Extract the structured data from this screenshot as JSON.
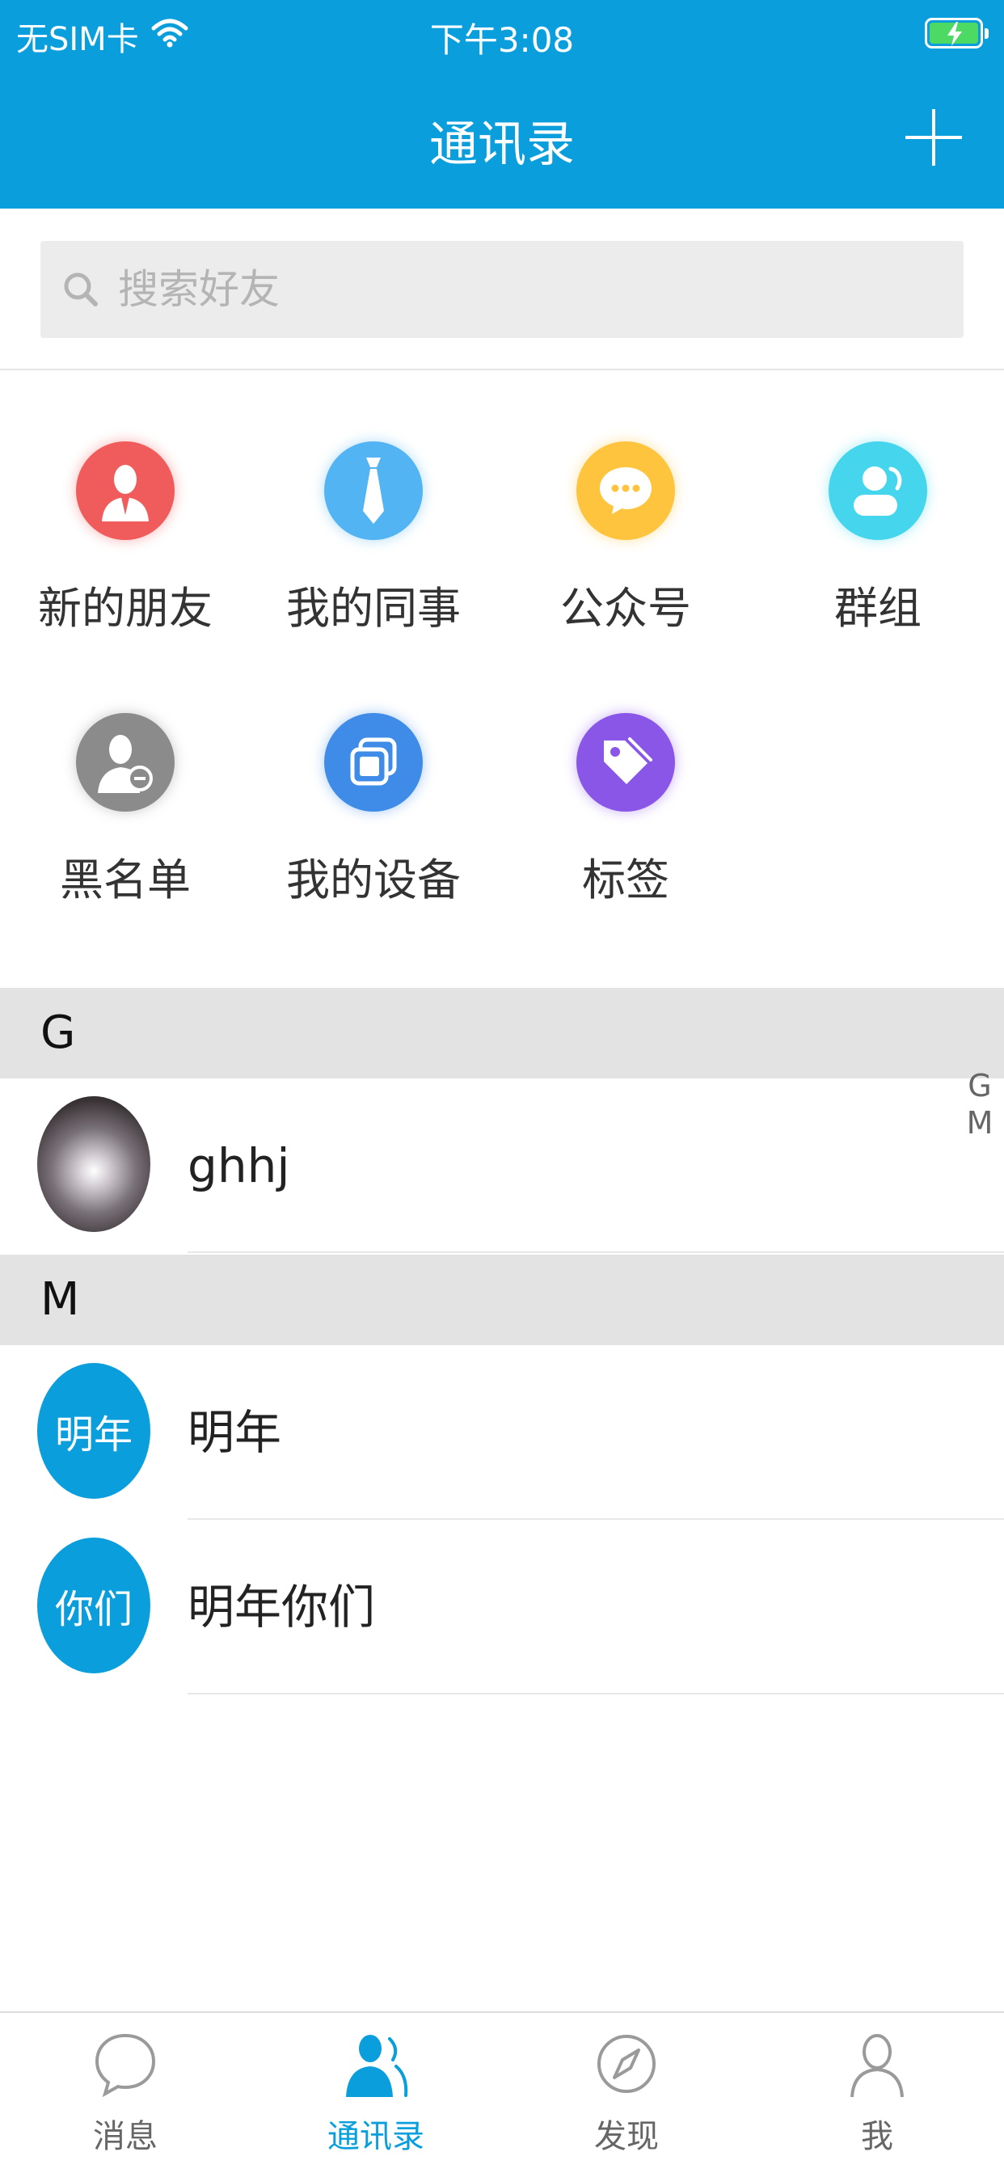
{
  "status_bar": {
    "carrier": "无SIM卡",
    "time": "下午3:08"
  },
  "header": {
    "title": "通讯录"
  },
  "search": {
    "placeholder": "搜索好友"
  },
  "shortcuts": [
    {
      "label": "新的朋友",
      "icon": "new-friend-icon",
      "color": "#f05b5b"
    },
    {
      "label": "我的同事",
      "icon": "colleague-tie-icon",
      "color": "#52b4f2"
    },
    {
      "label": "公众号",
      "icon": "chat-bubble-icon",
      "color": "#ffc43d"
    },
    {
      "label": "群组",
      "icon": "group-icon",
      "color": "#45d6ee"
    },
    {
      "label": "黑名单",
      "icon": "blacklist-user-icon",
      "color": "#8b8b8b"
    },
    {
      "label": "我的设备",
      "icon": "device-icon",
      "color": "#3f8be8"
    },
    {
      "label": "标签",
      "icon": "tag-icon",
      "color": "#8a56e8"
    }
  ],
  "sections": [
    {
      "letter": "G",
      "contacts": [
        {
          "name": "ghhj",
          "avatar_text": ""
        }
      ]
    },
    {
      "letter": "M",
      "contacts": [
        {
          "name": "明年",
          "avatar_text": "明年"
        },
        {
          "name": "明年你们",
          "avatar_text": "你们"
        }
      ]
    }
  ],
  "index_letters": [
    "G",
    "M"
  ],
  "tabs": [
    {
      "label": "消息",
      "icon": "message-bubble-icon"
    },
    {
      "label": "通讯录",
      "icon": "contacts-icon",
      "active": true
    },
    {
      "label": "发现",
      "icon": "compass-icon"
    },
    {
      "label": "我",
      "icon": "user-profile-icon"
    }
  ],
  "colors": {
    "brand": "#0a9fdc",
    "section_bg": "#e3e3e3"
  }
}
